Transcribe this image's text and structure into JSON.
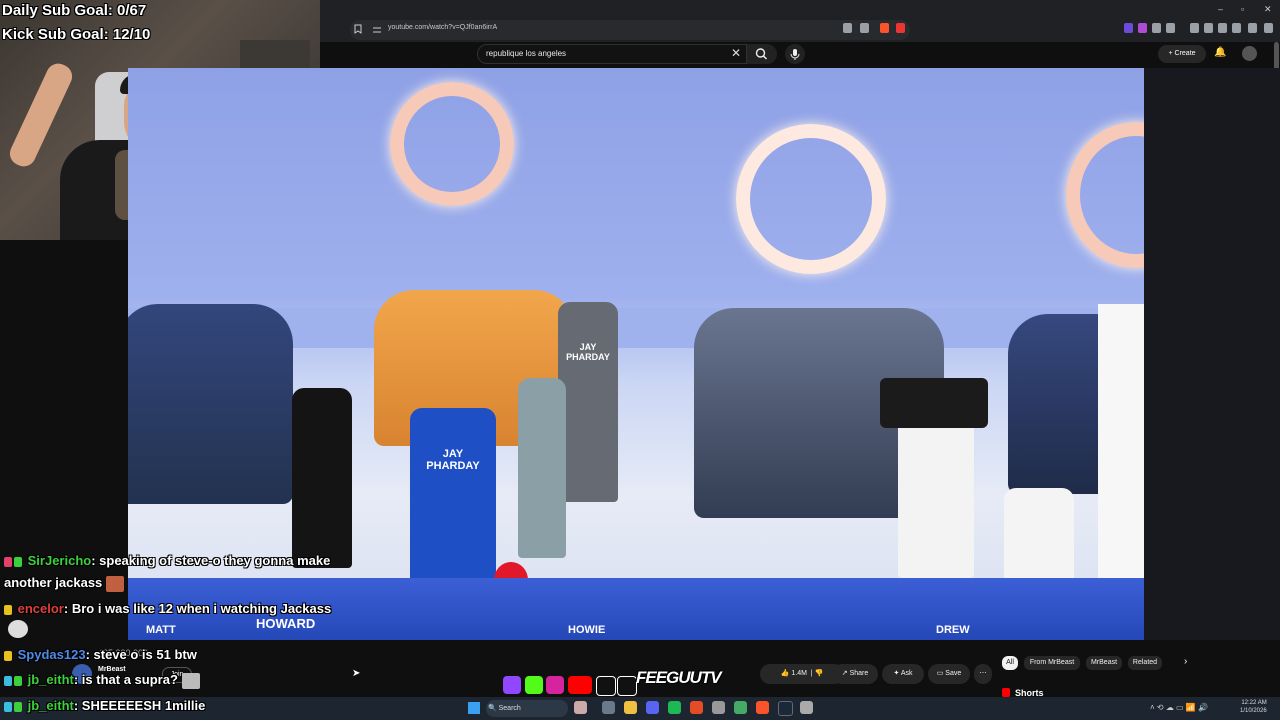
{
  "overlay": {
    "daily_goal": "Daily Sub Goal: 0/67",
    "kick_goal": "Kick Sub Goal: 12/10"
  },
  "browser": {
    "url": "youtube.com/watch?v=QJf0an6irrA"
  },
  "youtube": {
    "search_value": "republique los angeles",
    "create_label": "Create",
    "likes": "1.4M",
    "share_label": "Share",
    "ask_label": "Ask",
    "save_label": "Save",
    "channel_name": "MrBeast",
    "join_label": "Join",
    "subs_partial": "405,000,000",
    "filter_chips": [
      "All",
      "From MrBeast",
      "MrBeast",
      "Related"
    ],
    "shorts_label": "Shorts"
  },
  "video": {
    "shirt_text_1": "JAY\nPHARDAY",
    "shirt_text_2": "JAY\nPHARDAY",
    "jersey_names": [
      "MATT",
      "HOWARD",
      "HOWIE",
      "DREW"
    ]
  },
  "chat": [
    {
      "user": "SirJericho",
      "user_color": "#3cd13c",
      "text": ": speaking of steve-o they gonna make",
      "text_cont": "another jackass"
    },
    {
      "user": "encelor",
      "user_color": "#e0403c",
      "text": ": Bro i was like 12 when i watching Jackass"
    },
    {
      "user": "Spydas123",
      "user_color": "#4f8ae8",
      "text": ": steve o is 51 btw"
    },
    {
      "user": "jb_eitht",
      "user_color": "#3cd13c",
      "text": ": is that a supra?"
    },
    {
      "user": "jb_eitht",
      "user_color": "#3cd13c",
      "text": ": SHEEEEESH 1millie"
    }
  ],
  "banner": {
    "handle": "FEEGUUTV"
  },
  "taskbar": {
    "search_label": "Search",
    "time": "12:22 AM",
    "date": "1/10/2026"
  },
  "colors": {
    "video_bg": "#9fb0ee",
    "ring": "#f6c9b8",
    "youtube_red": "#ff0000"
  }
}
